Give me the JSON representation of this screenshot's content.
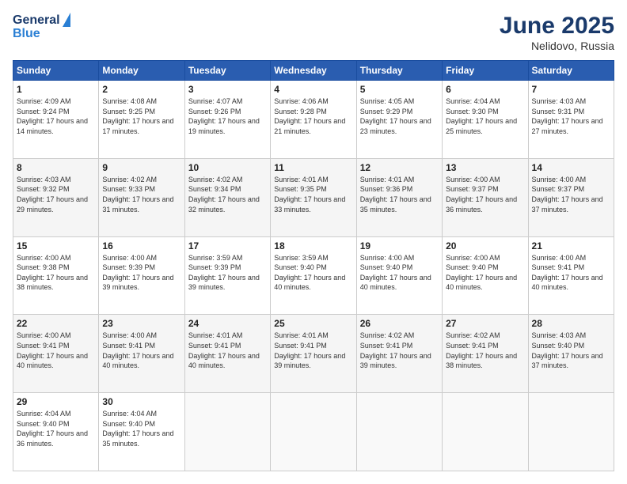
{
  "header": {
    "logo_general": "General",
    "logo_blue": "Blue",
    "month": "June 2025",
    "location": "Nelidovo, Russia"
  },
  "days_of_week": [
    "Sunday",
    "Monday",
    "Tuesday",
    "Wednesday",
    "Thursday",
    "Friday",
    "Saturday"
  ],
  "weeks": [
    [
      {
        "num": "1",
        "sunrise": "4:09 AM",
        "sunset": "9:24 PM",
        "daylight": "17 hours and 14 minutes."
      },
      {
        "num": "2",
        "sunrise": "4:08 AM",
        "sunset": "9:25 PM",
        "daylight": "17 hours and 17 minutes."
      },
      {
        "num": "3",
        "sunrise": "4:07 AM",
        "sunset": "9:26 PM",
        "daylight": "17 hours and 19 minutes."
      },
      {
        "num": "4",
        "sunrise": "4:06 AM",
        "sunset": "9:28 PM",
        "daylight": "17 hours and 21 minutes."
      },
      {
        "num": "5",
        "sunrise": "4:05 AM",
        "sunset": "9:29 PM",
        "daylight": "17 hours and 23 minutes."
      },
      {
        "num": "6",
        "sunrise": "4:04 AM",
        "sunset": "9:30 PM",
        "daylight": "17 hours and 25 minutes."
      },
      {
        "num": "7",
        "sunrise": "4:03 AM",
        "sunset": "9:31 PM",
        "daylight": "17 hours and 27 minutes."
      }
    ],
    [
      {
        "num": "8",
        "sunrise": "4:03 AM",
        "sunset": "9:32 PM",
        "daylight": "17 hours and 29 minutes."
      },
      {
        "num": "9",
        "sunrise": "4:02 AM",
        "sunset": "9:33 PM",
        "daylight": "17 hours and 31 minutes."
      },
      {
        "num": "10",
        "sunrise": "4:02 AM",
        "sunset": "9:34 PM",
        "daylight": "17 hours and 32 minutes."
      },
      {
        "num": "11",
        "sunrise": "4:01 AM",
        "sunset": "9:35 PM",
        "daylight": "17 hours and 33 minutes."
      },
      {
        "num": "12",
        "sunrise": "4:01 AM",
        "sunset": "9:36 PM",
        "daylight": "17 hours and 35 minutes."
      },
      {
        "num": "13",
        "sunrise": "4:00 AM",
        "sunset": "9:37 PM",
        "daylight": "17 hours and 36 minutes."
      },
      {
        "num": "14",
        "sunrise": "4:00 AM",
        "sunset": "9:37 PM",
        "daylight": "17 hours and 37 minutes."
      }
    ],
    [
      {
        "num": "15",
        "sunrise": "4:00 AM",
        "sunset": "9:38 PM",
        "daylight": "17 hours and 38 minutes."
      },
      {
        "num": "16",
        "sunrise": "4:00 AM",
        "sunset": "9:39 PM",
        "daylight": "17 hours and 39 minutes."
      },
      {
        "num": "17",
        "sunrise": "3:59 AM",
        "sunset": "9:39 PM",
        "daylight": "17 hours and 39 minutes."
      },
      {
        "num": "18",
        "sunrise": "3:59 AM",
        "sunset": "9:40 PM",
        "daylight": "17 hours and 40 minutes."
      },
      {
        "num": "19",
        "sunrise": "4:00 AM",
        "sunset": "9:40 PM",
        "daylight": "17 hours and 40 minutes."
      },
      {
        "num": "20",
        "sunrise": "4:00 AM",
        "sunset": "9:40 PM",
        "daylight": "17 hours and 40 minutes."
      },
      {
        "num": "21",
        "sunrise": "4:00 AM",
        "sunset": "9:41 PM",
        "daylight": "17 hours and 40 minutes."
      }
    ],
    [
      {
        "num": "22",
        "sunrise": "4:00 AM",
        "sunset": "9:41 PM",
        "daylight": "17 hours and 40 minutes."
      },
      {
        "num": "23",
        "sunrise": "4:00 AM",
        "sunset": "9:41 PM",
        "daylight": "17 hours and 40 minutes."
      },
      {
        "num": "24",
        "sunrise": "4:01 AM",
        "sunset": "9:41 PM",
        "daylight": "17 hours and 40 minutes."
      },
      {
        "num": "25",
        "sunrise": "4:01 AM",
        "sunset": "9:41 PM",
        "daylight": "17 hours and 39 minutes."
      },
      {
        "num": "26",
        "sunrise": "4:02 AM",
        "sunset": "9:41 PM",
        "daylight": "17 hours and 39 minutes."
      },
      {
        "num": "27",
        "sunrise": "4:02 AM",
        "sunset": "9:41 PM",
        "daylight": "17 hours and 38 minutes."
      },
      {
        "num": "28",
        "sunrise": "4:03 AM",
        "sunset": "9:40 PM",
        "daylight": "17 hours and 37 minutes."
      }
    ],
    [
      {
        "num": "29",
        "sunrise": "4:04 AM",
        "sunset": "9:40 PM",
        "daylight": "17 hours and 36 minutes."
      },
      {
        "num": "30",
        "sunrise": "4:04 AM",
        "sunset": "9:40 PM",
        "daylight": "17 hours and 35 minutes."
      },
      null,
      null,
      null,
      null,
      null
    ]
  ]
}
